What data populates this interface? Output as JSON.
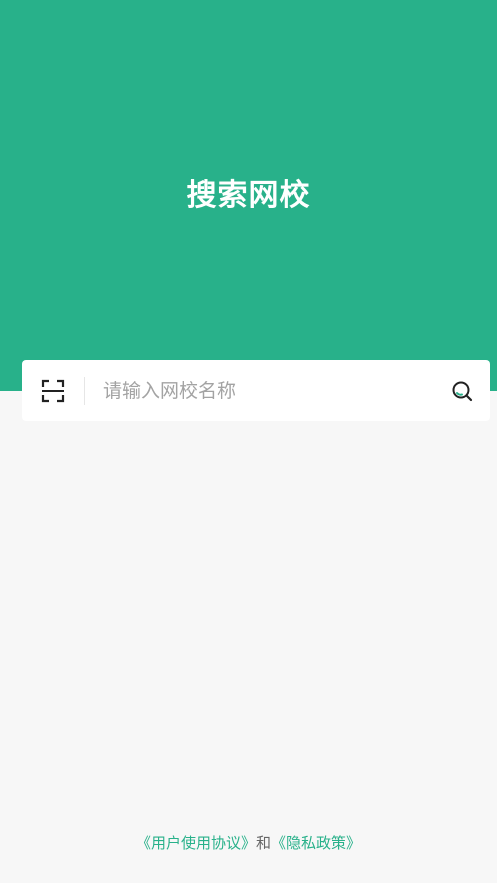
{
  "header": {
    "title": "搜索网校"
  },
  "search": {
    "placeholder": "请输入网校名称",
    "value": "",
    "scan_icon": "scan-icon",
    "search_icon": "search-icon"
  },
  "footer": {
    "user_agreement": "《用户使用协议》",
    "joiner": "和",
    "privacy_policy": "《隐私政策》"
  },
  "colors": {
    "brand": "#28b18a",
    "background": "#f7f7f7",
    "placeholder": "#a3a3a3"
  }
}
